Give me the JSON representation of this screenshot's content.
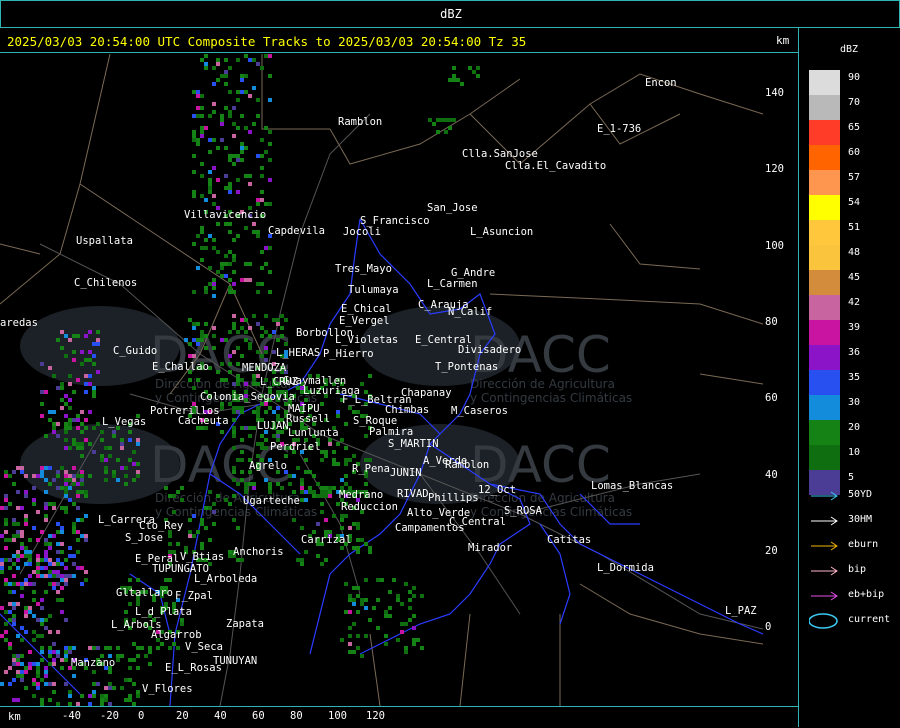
{
  "window": {
    "title": "dBZ"
  },
  "header": {
    "text": "2025/03/03 20:54:00 UTC Composite Tracks to 2025/03/03 20:54:00 Tz 35",
    "unit": "km"
  },
  "legend": {
    "title": "dBZ",
    "levels": [
      {
        "label": "90",
        "color": "#dcdcdc"
      },
      {
        "label": "70",
        "color": "#b9b9b9"
      },
      {
        "label": "65",
        "color": "#ff3c28"
      },
      {
        "label": "60",
        "color": "#ff6400"
      },
      {
        "label": "57",
        "color": "#ff9650"
      },
      {
        "label": "54",
        "color": "#ffff00"
      },
      {
        "label": "51",
        "color": "#ffc83c"
      },
      {
        "label": "48",
        "color": "#fac43c"
      },
      {
        "label": "45",
        "color": "#d28c3c"
      },
      {
        "label": "42",
        "color": "#c864a0"
      },
      {
        "label": "39",
        "color": "#c814a0"
      },
      {
        "label": "36",
        "color": "#8c14c8"
      },
      {
        "label": "35",
        "color": "#2850f0"
      },
      {
        "label": "30",
        "color": "#148cdc"
      },
      {
        "label": "20",
        "color": "#148214"
      },
      {
        "label": "10",
        "color": "#0f6e0f"
      },
      {
        "label": "5",
        "color": "#4b3c96"
      }
    ],
    "tracks": [
      {
        "label": "50YD",
        "color": "#3cc8f0"
      },
      {
        "label": "30HM",
        "color": "#ffffff"
      },
      {
        "label": "eburn",
        "color": "#f0b400"
      },
      {
        "label": "bip",
        "color": "#ffb4c8"
      },
      {
        "label": "eb+bip",
        "color": "#e650e6"
      },
      {
        "label": "current",
        "color": "#3cc8f0"
      }
    ]
  },
  "axes": {
    "y_ticks": [
      "140",
      "120",
      "100",
      "80",
      "60",
      "40",
      "20",
      "0"
    ],
    "x_ticks": [
      "-40",
      "-20",
      "0",
      "20",
      "40",
      "60",
      "80",
      "100",
      "120"
    ],
    "x_unit": "km"
  },
  "map": {
    "watermark": [
      "DACC",
      "Dirección de Agricultura",
      "y Contingencias Climáticas"
    ],
    "places": [
      "Encon",
      "E_1-736",
      "Ramblon",
      "Clla.SanJose",
      "Clla.El_Cavadito",
      "San_Jose",
      "Villavicencio",
      "S_Francisco",
      "Jocoli",
      "L_Asuncion",
      "Uspallata",
      "Capdevila",
      "Tres_Mayo",
      "G_Andre",
      "Tulumaya",
      "L_Carmen",
      "C_Chilenos",
      "E_Chical",
      "C_Arauja",
      "N_Calif",
      "E_Vergel",
      "Borbollon",
      "E_Central",
      "Divisadero",
      "C_Guido",
      "L_Violetas",
      "P_Hierro",
      "MENDOZA",
      "L_HERAS",
      "Guaymallen",
      "E_Challao",
      "T_Pontenas",
      "Potrerillos",
      "Cacheuta",
      "L_Vegas",
      "Chapanay",
      "F_L_Beltran",
      "Chimbas",
      "M_Caseros",
      "Russell",
      "S_Roque",
      "Palmira",
      "S_MARTIN",
      "A_Verde",
      "Ramblon",
      "R_Pena",
      "JUNIN",
      "LUJAN",
      "Perdriel",
      "Agrelo",
      "Ugarteche",
      "Medrano",
      "RIVAD",
      "Phillips",
      "12_Oct",
      "Lomas_Blancas",
      "Reduccion",
      "Alto_Verde",
      "S_ROSA",
      "C_Central",
      "Campamentos",
      "Catitas",
      "L_Dormida",
      "Mirador",
      "Carrizal",
      "Anchoris",
      "L_Carrera",
      "Cto_Rey",
      "S_Jose",
      "E_Peral",
      "V_Btias",
      "TUPUNGATO",
      "L_Arboleda",
      "Gltallaro",
      "F_Zpal",
      "L_d_Plata",
      "L_Arbols",
      "Algarrob",
      "V_Seca",
      "Zapata",
      "Manzano",
      "E_L_Rosas",
      "TUNUYAN",
      "V_Flores",
      "L_PAZ",
      "aredas",
      "Luzuriaga",
      "MAIPU",
      "Lunlunta",
      "L_CRUZ",
      "Colonia_Segovia"
    ]
  }
}
